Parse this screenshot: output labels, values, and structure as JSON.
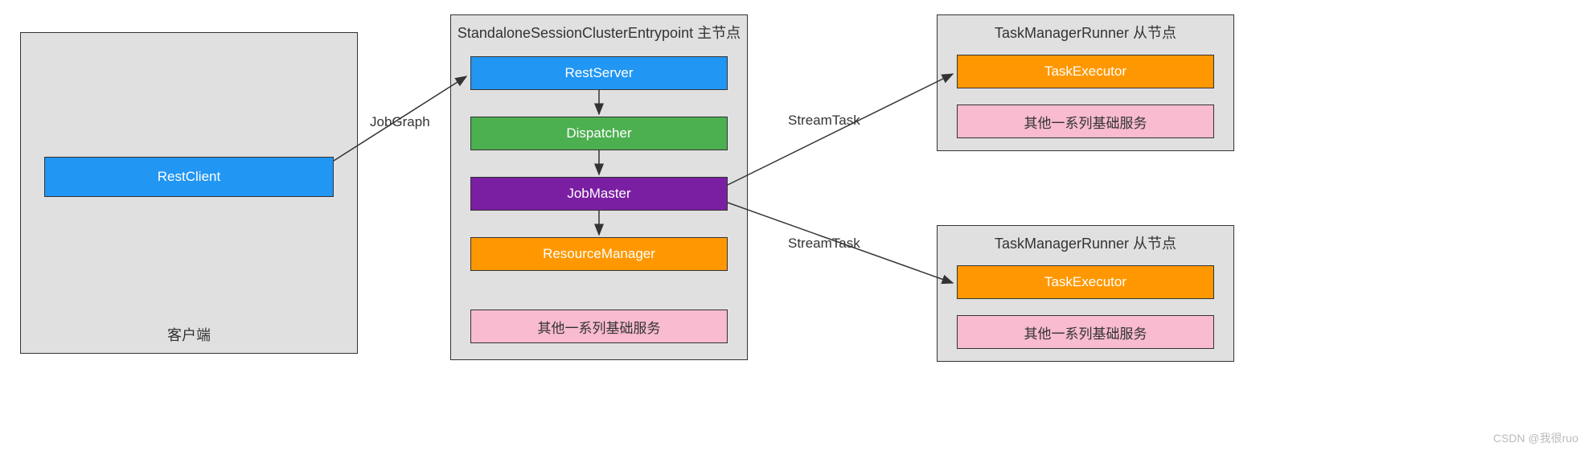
{
  "client": {
    "title": "客户端",
    "restClient": "RestClient"
  },
  "master": {
    "title": "StandaloneSessionClusterEntrypoint 主节点",
    "restServer": "RestServer",
    "dispatcher": "Dispatcher",
    "jobMaster": "JobMaster",
    "resourceManager": "ResourceManager",
    "otherServices": "其他一系列基础服务"
  },
  "worker1": {
    "title": "TaskManagerRunner 从节点",
    "taskExecutor": "TaskExecutor",
    "otherServices": "其他一系列基础服务"
  },
  "worker2": {
    "title": "TaskManagerRunner 从节点",
    "taskExecutor": "TaskExecutor",
    "otherServices": "其他一系列基础服务"
  },
  "labels": {
    "jobGraph": "JobGraph",
    "streamTask1": "StreamTask",
    "streamTask2": "StreamTask"
  },
  "watermark": "CSDN @我很ruo"
}
